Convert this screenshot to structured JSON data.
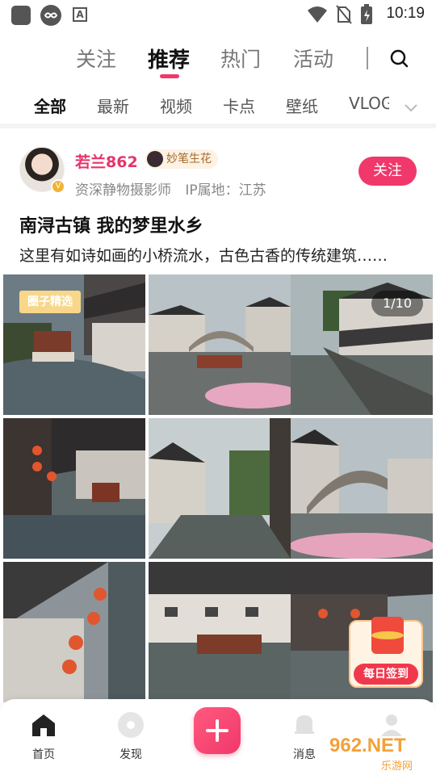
{
  "status_bar": {
    "time": "10:19",
    "icons": [
      "app-square-icon",
      "infinity-icon",
      "text-a-icon",
      "wifi-icon",
      "no-sim-icon",
      "battery-charging-icon"
    ]
  },
  "top_tabs": [
    {
      "label": "关注",
      "active": false
    },
    {
      "label": "推荐",
      "active": true
    },
    {
      "label": "热门",
      "active": false
    },
    {
      "label": "活动",
      "active": false
    }
  ],
  "sub_tabs": [
    {
      "label": "全部",
      "active": true
    },
    {
      "label": "最新",
      "active": false
    },
    {
      "label": "视频",
      "active": false
    },
    {
      "label": "卡点",
      "active": false
    },
    {
      "label": "壁纸",
      "active": false
    },
    {
      "label": "VLOG",
      "active": false
    }
  ],
  "post": {
    "username": "若兰862",
    "tag": "妙笔生花",
    "bio": "资深静物摄影师",
    "ip": "IP属地：江苏",
    "follow_label": "关注",
    "title": "南浔古镇 我的梦里水乡",
    "desc": "这里有如诗如画的小桥流水，古色古香的传统建筑……",
    "badge_label": "圈子精选",
    "image_count": "1/10"
  },
  "daily_checkin": {
    "label": "每日签到"
  },
  "bottom_nav": [
    {
      "label": "首页",
      "icon": "home-icon"
    },
    {
      "label": "发现",
      "icon": "discover-icon"
    },
    {
      "label": "",
      "icon": "plus-icon"
    },
    {
      "label": "消息",
      "icon": "bell-icon"
    },
    {
      "label": "",
      "icon": "profile-icon"
    }
  ],
  "watermark": {
    "text": "962.NET",
    "subtext": "乐游网"
  },
  "colors": {
    "accent": "#f0386b",
    "tag_bg": "#fdf2e4",
    "badge_gold": "#f8d78a"
  }
}
